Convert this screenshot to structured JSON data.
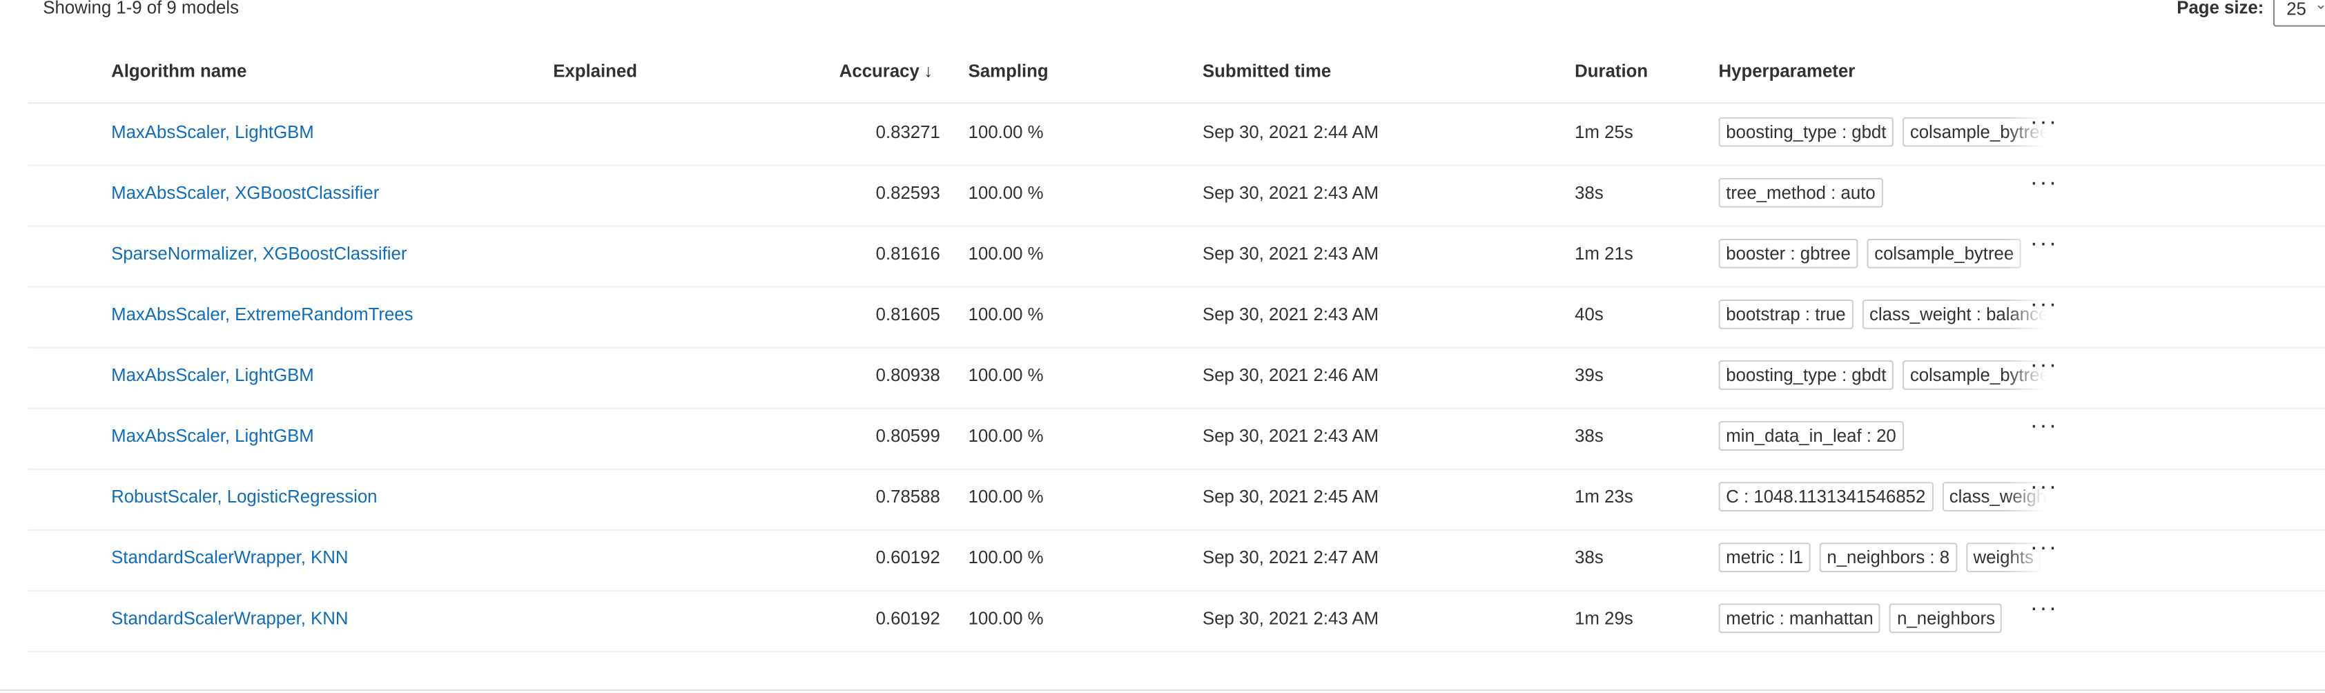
{
  "summary": {
    "showing": "Showing 1-9 of 9 models"
  },
  "page_size": {
    "label": "Page size:",
    "value": "25",
    "icon": "chevron-down-icon"
  },
  "columns": {
    "algorithm": "Algorithm name",
    "explained": "Explained",
    "accuracy": "Accuracy",
    "accuracy_sort_icon": "↓",
    "sampling": "Sampling",
    "submitted": "Submitted time",
    "duration": "Duration",
    "hyperparameter": "Hyperparameter"
  },
  "more_icon": "···",
  "rows": [
    {
      "algorithm": "MaxAbsScaler, LightGBM",
      "accuracy": "0.83271",
      "sampling": "100.00 %",
      "submitted": "Sep 30, 2021 2:44 AM",
      "duration": "1m 25s",
      "params": [
        "boosting_type : gbdt",
        "colsample_bytree"
      ]
    },
    {
      "algorithm": "MaxAbsScaler, XGBoostClassifier",
      "accuracy": "0.82593",
      "sampling": "100.00 %",
      "submitted": "Sep 30, 2021 2:43 AM",
      "duration": "38s",
      "params": [
        "tree_method : auto"
      ]
    },
    {
      "algorithm": "SparseNormalizer, XGBoostClassifier",
      "accuracy": "0.81616",
      "sampling": "100.00 %",
      "submitted": "Sep 30, 2021 2:43 AM",
      "duration": "1m 21s",
      "params": [
        "booster : gbtree",
        "colsample_bytree"
      ]
    },
    {
      "algorithm": "MaxAbsScaler, ExtremeRandomTrees",
      "accuracy": "0.81605",
      "sampling": "100.00 %",
      "submitted": "Sep 30, 2021 2:43 AM",
      "duration": "40s",
      "params": [
        "bootstrap : true",
        "class_weight : balanced"
      ]
    },
    {
      "algorithm": "MaxAbsScaler, LightGBM",
      "accuracy": "0.80938",
      "sampling": "100.00 %",
      "submitted": "Sep 30, 2021 2:46 AM",
      "duration": "39s",
      "params": [
        "boosting_type : gbdt",
        "colsample_bytree"
      ]
    },
    {
      "algorithm": "MaxAbsScaler, LightGBM",
      "accuracy": "0.80599",
      "sampling": "100.00 %",
      "submitted": "Sep 30, 2021 2:43 AM",
      "duration": "38s",
      "params": [
        "min_data_in_leaf : 20"
      ]
    },
    {
      "algorithm": "RobustScaler, LogisticRegression",
      "accuracy": "0.78588",
      "sampling": "100.00 %",
      "submitted": "Sep 30, 2021 2:45 AM",
      "duration": "1m 23s",
      "params": [
        "C : 1048.1131341546852",
        "class_weight"
      ]
    },
    {
      "algorithm": "StandardScalerWrapper, KNN",
      "accuracy": "0.60192",
      "sampling": "100.00 %",
      "submitted": "Sep 30, 2021 2:47 AM",
      "duration": "38s",
      "params": [
        "metric : l1",
        "n_neighbors : 8",
        "weights"
      ]
    },
    {
      "algorithm": "StandardScalerWrapper, KNN",
      "accuracy": "0.60192",
      "sampling": "100.00 %",
      "submitted": "Sep 30, 2021 2:43 AM",
      "duration": "1m 29s",
      "params": [
        "metric : manhattan",
        "n_neighbors"
      ]
    }
  ]
}
